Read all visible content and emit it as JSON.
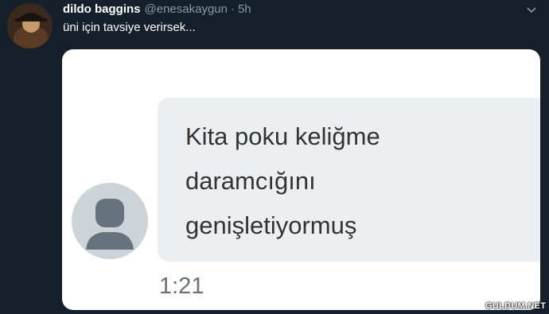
{
  "tweet": {
    "display_name": "dildo baggins",
    "handle": "@enesakaygun",
    "separator": "·",
    "time": "5h",
    "text": "üni için tavsiye verirsek..."
  },
  "message": {
    "lines": [
      "Kita poku keliğme",
      "daramcığını",
      "genişletiyormuş"
    ],
    "time": "1:21"
  },
  "watermark": "GULDUM.NET",
  "icons": {
    "tweet_menu": "chevron-down-icon",
    "contact_avatar": "person-icon"
  },
  "colors": {
    "background": "#15202b",
    "secondary_text": "#8899a6",
    "bubble": "#eceff1"
  }
}
